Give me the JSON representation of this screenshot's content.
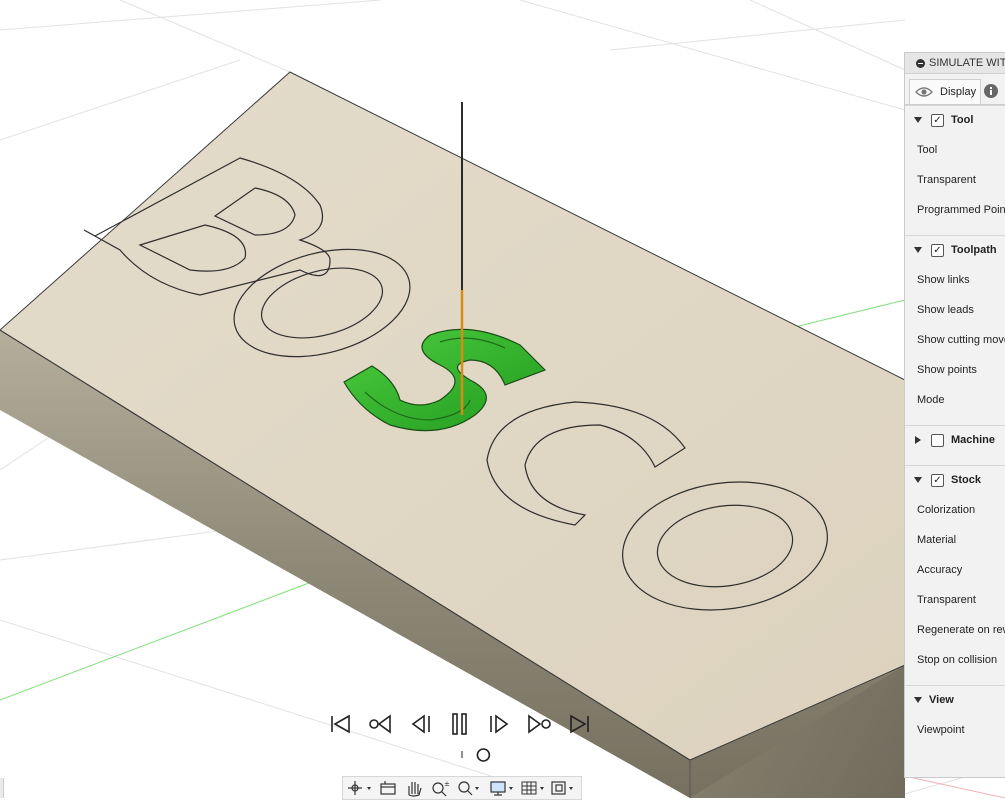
{
  "model": {
    "engraved_text": [
      "B",
      "O",
      "S",
      "C",
      "O"
    ]
  },
  "colors": {
    "stock": "#dfd5c2",
    "stock_side": "#9a9483",
    "cut": "#35b82f",
    "tool_holder": "#2b2b2b",
    "tool_bit": "#d98b17"
  },
  "panel": {
    "title": "SIMULATE WIT",
    "tabs": [
      {
        "label": "Display",
        "icon": "eye-icon"
      },
      {
        "label": "",
        "icon": "info-icon"
      }
    ],
    "sections": [
      {
        "label": "Tool",
        "checked": true,
        "expanded": true,
        "items": [
          "Tool",
          "Transparent",
          "Programmed Poin"
        ]
      },
      {
        "label": "Toolpath",
        "checked": true,
        "expanded": true,
        "items": [
          "Show links",
          "Show leads",
          "Show cutting move",
          "Show points",
          "Mode"
        ]
      },
      {
        "label": "Machine",
        "checked": false,
        "expanded": false,
        "items": []
      },
      {
        "label": "Stock",
        "checked": true,
        "expanded": true,
        "items": [
          "Colorization",
          "Material",
          "Accuracy",
          "Transparent",
          "Regenerate on rew",
          "Stop on collision"
        ]
      },
      {
        "label": "View",
        "expanded": true,
        "items": [
          "Viewpoint"
        ]
      }
    ]
  },
  "playback": {
    "buttons": [
      "go-to-start",
      "previous-operation",
      "step-back",
      "pause",
      "step-forward",
      "next-operation",
      "go-to-end"
    ],
    "progress": 0.58
  },
  "toolbar": {
    "icons": [
      "orbit-icon",
      "look-at-icon",
      "pan-icon",
      "zoom-icon",
      "fit-icon",
      "display-settings-icon",
      "grid-icon",
      "viewports-icon"
    ]
  }
}
